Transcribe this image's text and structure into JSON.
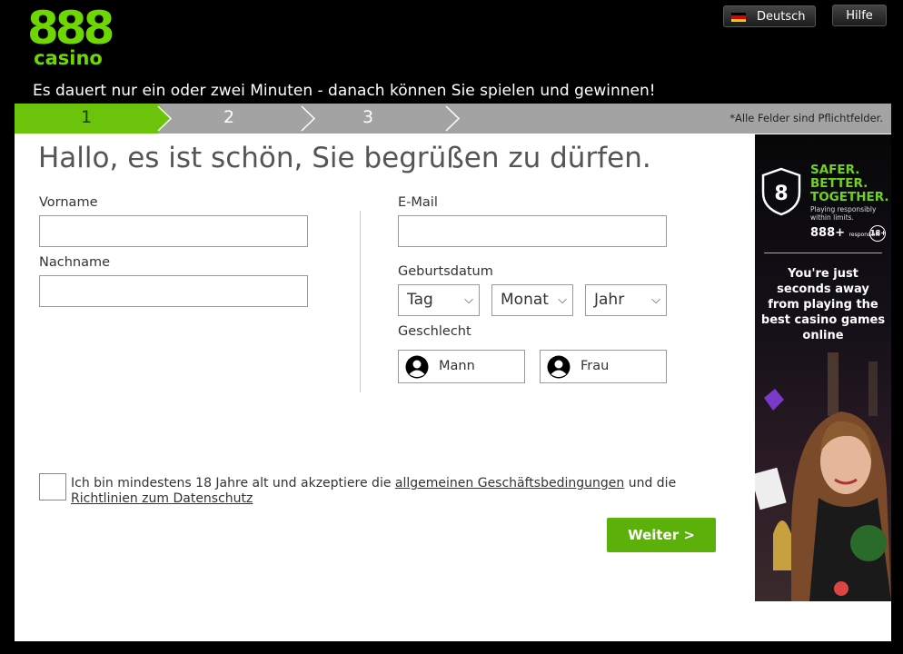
{
  "logo": {
    "numbers": "888",
    "word": "casino"
  },
  "header": {
    "language_label": "Deutsch",
    "help_label": "Hilfe",
    "tagline": "Es dauert nur ein oder zwei Minuten - danach können Sie spielen und gewinnen!"
  },
  "steps": {
    "items": [
      "1",
      "2",
      "3"
    ],
    "active": 1,
    "required_note": "*Alle Felder sind Pflichtfelder."
  },
  "form": {
    "greeting": "Hallo, es ist schön, Sie begrüßen zu dürfen.",
    "first_name_label": "Vorname",
    "last_name_label": "Nachname",
    "email_label": "E-Mail",
    "birthdate_label": "Geburtsdatum",
    "day_select": "Tag",
    "month_select": "Monat",
    "year_select": "Jahr",
    "gender_label": "Geschlecht",
    "gender_male": "Mann",
    "gender_female": "Frau",
    "terms_prefix": "Ich bin mindestens 18 Jahre alt und akzeptiere die",
    "terms_link": "allgemeinen Geschäftsbedingungen",
    "terms_middle": "und die",
    "privacy_link": "Richtlinien zum Datenschutz",
    "submit_label": "Weiter >"
  },
  "banner": {
    "shield_number": "8",
    "slogan_lines": [
      "SAFER.",
      "BETTER.",
      "TOGETHER."
    ],
    "subline_1": "Playing responsibly",
    "subline_2": "within limits.",
    "responsible_brand": "888+",
    "responsible_word": "responsible",
    "age_badge": "18+",
    "promo_text": "You're just seconds away from playing the best casino games online"
  },
  "colors": {
    "brand_green": "#6ed600",
    "button_green": "#5bb00a",
    "step_active": "#6cc30b",
    "step_inactive": "#a3a3a3"
  }
}
